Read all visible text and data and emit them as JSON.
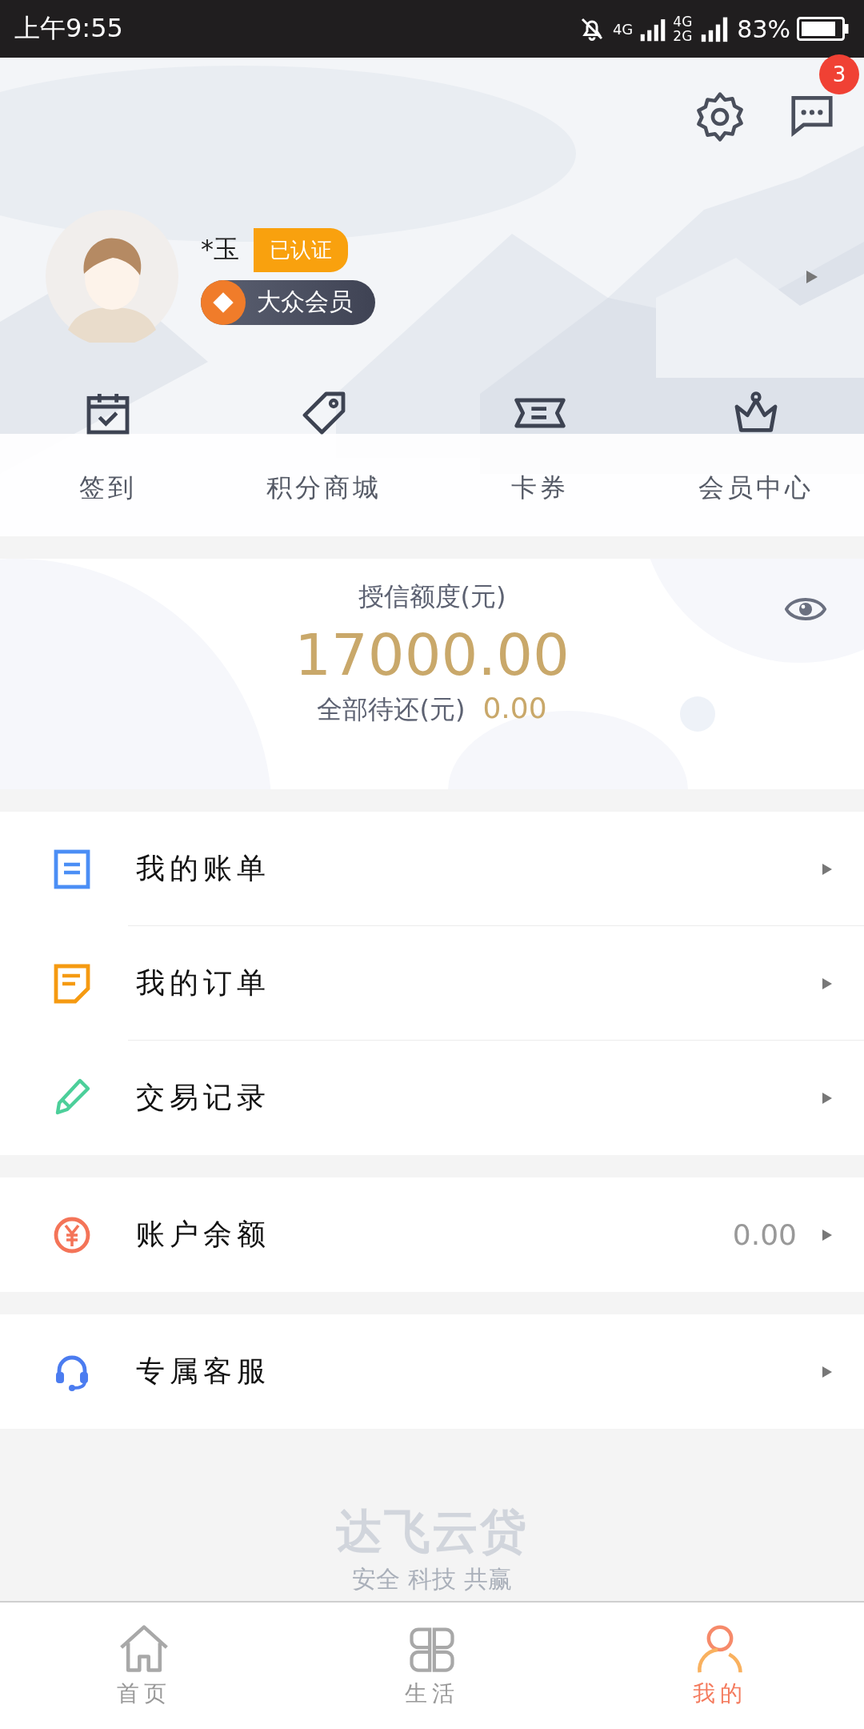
{
  "status_bar": {
    "time": "上午9:55",
    "network_1": "4G",
    "network_2": "4G",
    "network_3": "2G",
    "battery": "83%"
  },
  "header": {
    "message_badge": "3",
    "user": {
      "name": "*玉",
      "verified_badge": "已认证",
      "member_level": "大众会员"
    },
    "shortcuts": [
      {
        "label": "签到",
        "kind": "calendar"
      },
      {
        "label": "积分商城",
        "kind": "tag"
      },
      {
        "label": "卡券",
        "kind": "ticket"
      },
      {
        "label": "会员中心",
        "kind": "crown"
      }
    ]
  },
  "credit": {
    "title": "授信额度(元)",
    "amount": "17000.00",
    "pending_label": "全部待还(元)",
    "pending_amount": "0.00"
  },
  "menu_groups": [
    {
      "items": [
        {
          "label": "我的账单",
          "kind": "bill"
        },
        {
          "label": "我的订单",
          "kind": "order"
        },
        {
          "label": "交易记录",
          "kind": "pencil"
        }
      ]
    },
    {
      "items": [
        {
          "label": "账户余额",
          "kind": "yuan",
          "value": "0.00"
        }
      ]
    },
    {
      "items": [
        {
          "label": "专属客服",
          "kind": "headset"
        }
      ]
    }
  ],
  "footer": {
    "brand": "达飞云贷",
    "slogan": "安全 科技 共赢"
  },
  "tab_bar": [
    {
      "label": "首页",
      "kind": "home",
      "selected": false
    },
    {
      "label": "生活",
      "kind": "grid",
      "selected": false
    },
    {
      "label": "我的",
      "kind": "person",
      "selected": true
    }
  ]
}
